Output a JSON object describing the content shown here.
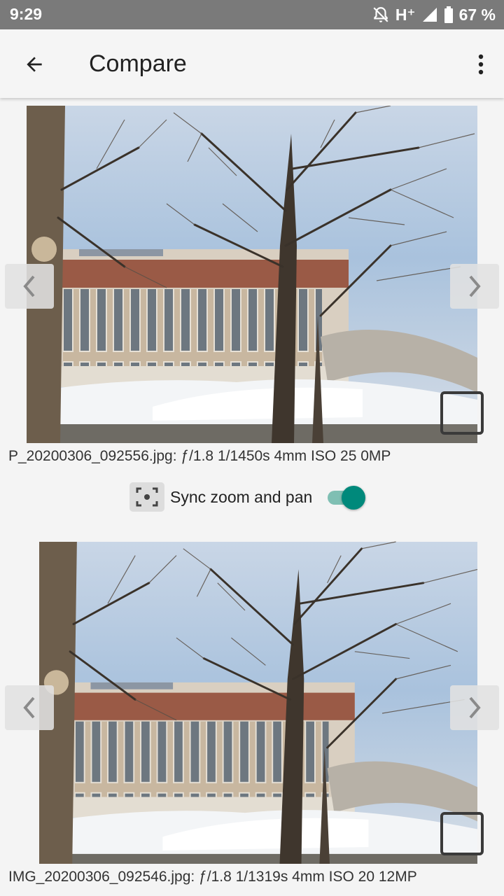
{
  "status_bar": {
    "time": "9:29",
    "network": "H⁺",
    "battery": "67 %",
    "icons": [
      "alarm-off-icon",
      "signal-icon",
      "battery-icon"
    ]
  },
  "app_bar": {
    "title": "Compare",
    "icons": [
      "back-arrow-icon",
      "more-vert-icon"
    ]
  },
  "photos": [
    {
      "caption": "P_20200306_092556.jpg: ƒ/1.8 1/1450s 4mm ISO 25 0MP"
    },
    {
      "caption": "IMG_20200306_092546.jpg: ƒ/1.8 1/1319s 4mm ISO 20 12MP"
    }
  ],
  "sync": {
    "label": "Sync zoom and pan",
    "enabled": true,
    "icon": "sync-frame-icon"
  },
  "colors": {
    "status_bar": "#7a7a7a",
    "app_bar": "#f5f5f5",
    "toggle_on": "#00897b",
    "toggle_track": "#7fbfb3"
  }
}
